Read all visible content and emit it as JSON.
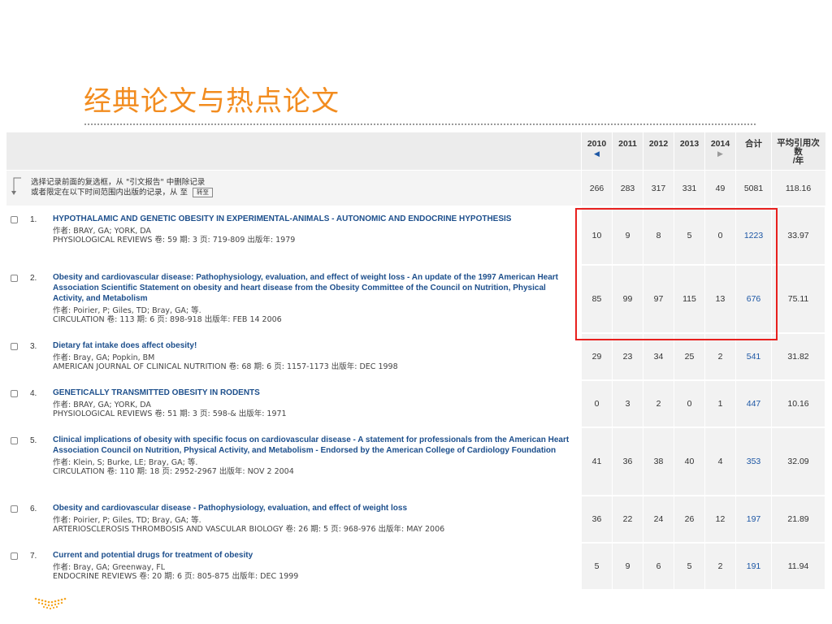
{
  "slide": {
    "title": "经典论文与热点论文"
  },
  "header": {
    "years": [
      {
        "label": "2010",
        "arrow": "◀"
      },
      {
        "label": "2011",
        "arrow": ""
      },
      {
        "label": "2012",
        "arrow": ""
      },
      {
        "label": "2013",
        "arrow": ""
      },
      {
        "label": "2014",
        "arrow": "▶"
      }
    ],
    "total_label": "合计",
    "avg_label_line1": "平均引用次",
    "avg_label_line2": "数",
    "avg_label_line3": "/年"
  },
  "summary": {
    "instruction_line1": "选择记录前面的复选框，从 \"引文报告\" 中删除记录",
    "instruction_line2": "或者限定在以下时间范围内出版的记录，从  至",
    "goto_label": "转至",
    "values": [
      "266",
      "283",
      "317",
      "331",
      "49"
    ],
    "total": "5081",
    "avg": "118.16"
  },
  "records": [
    {
      "num": "1.",
      "title": "HYPOTHALAMIC AND GENETIC OBESITY IN EXPERIMENTAL-ANIMALS - AUTONOMIC AND ENDOCRINE HYPOTHESIS",
      "authors": "作者: BRAY, GA; YORK, DA",
      "source": "PHYSIOLOGICAL REVIEWS  卷: 59   期: 3   页: 719-809   出版年: 1979",
      "values": [
        "10",
        "9",
        "8",
        "5",
        "0"
      ],
      "total": "1223",
      "avg": "33.97"
    },
    {
      "num": "2.",
      "title": "Obesity and cardiovascular disease: Pathophysiology, evaluation, and effect of weight loss - An update of the 1997 American Heart Association Scientific Statement on obesity and heart disease from the Obesity Committee of the Council on Nutrition, Physical Activity, and Metabolism",
      "authors": "作者: Poirier, P; Giles, TD; Bray, GA; 等.",
      "source": "CIRCULATION  卷: 113   期: 6   页: 898-918   出版年: FEB 14 2006",
      "values": [
        "85",
        "99",
        "97",
        "115",
        "13"
      ],
      "total": "676",
      "avg": "75.11"
    },
    {
      "num": "3.",
      "title": "Dietary fat intake does affect obesity!",
      "authors": "作者: Bray, GA; Popkin, BM",
      "source": "AMERICAN JOURNAL OF CLINICAL NUTRITION  卷: 68   期: 6   页: 1157-1173   出版年: DEC 1998",
      "values": [
        "29",
        "23",
        "34",
        "25",
        "2"
      ],
      "total": "541",
      "avg": "31.82"
    },
    {
      "num": "4.",
      "title": "GENETICALLY TRANSMITTED OBESITY IN RODENTS",
      "authors": "作者: BRAY, GA; YORK, DA",
      "source": "PHYSIOLOGICAL REVIEWS  卷: 51   期: 3   页: 598-&   出版年: 1971",
      "values": [
        "0",
        "3",
        "2",
        "0",
        "1"
      ],
      "total": "447",
      "avg": "10.16"
    },
    {
      "num": "5.",
      "title": "Clinical implications of obesity with specific focus on cardiovascular disease - A statement for professionals from the American Heart Association Council on Nutrition, Physical Activity, and Metabolism - Endorsed by the American College of Cardiology Foundation",
      "authors": "作者: Klein, S; Burke, LE; Bray, GA; 等.",
      "source": "CIRCULATION  卷: 110   期: 18   页: 2952-2967   出版年: NOV 2 2004",
      "values": [
        "41",
        "36",
        "38",
        "40",
        "4"
      ],
      "total": "353",
      "avg": "32.09"
    },
    {
      "num": "6.",
      "title": "Obesity and cardiovascular disease - Pathophysiology, evaluation, and effect of weight loss",
      "authors": "作者: Poirier, P; Giles, TD; Bray, GA; 等.",
      "source": "ARTERIOSCLEROSIS THROMBOSIS AND VASCULAR BIOLOGY  卷: 26   期: 5   页: 968-976   出版年: MAY 2006",
      "values": [
        "36",
        "22",
        "24",
        "26",
        "12"
      ],
      "total": "197",
      "avg": "21.89"
    },
    {
      "num": "7.",
      "title": "Current and potential drugs for treatment of obesity",
      "authors": "作者: Bray, GA; Greenway, FL",
      "source": "ENDOCRINE REVIEWS  卷: 20   期: 6   页: 805-875   出版年: DEC 1999",
      "values": [
        "5",
        "9",
        "6",
        "5",
        "2"
      ],
      "total": "191",
      "avg": "11.94"
    }
  ],
  "colors": {
    "title": "#f28c1f",
    "link": "#1d57a5",
    "record_title": "#1d4f8c",
    "highlight_box": "#e8201e"
  }
}
